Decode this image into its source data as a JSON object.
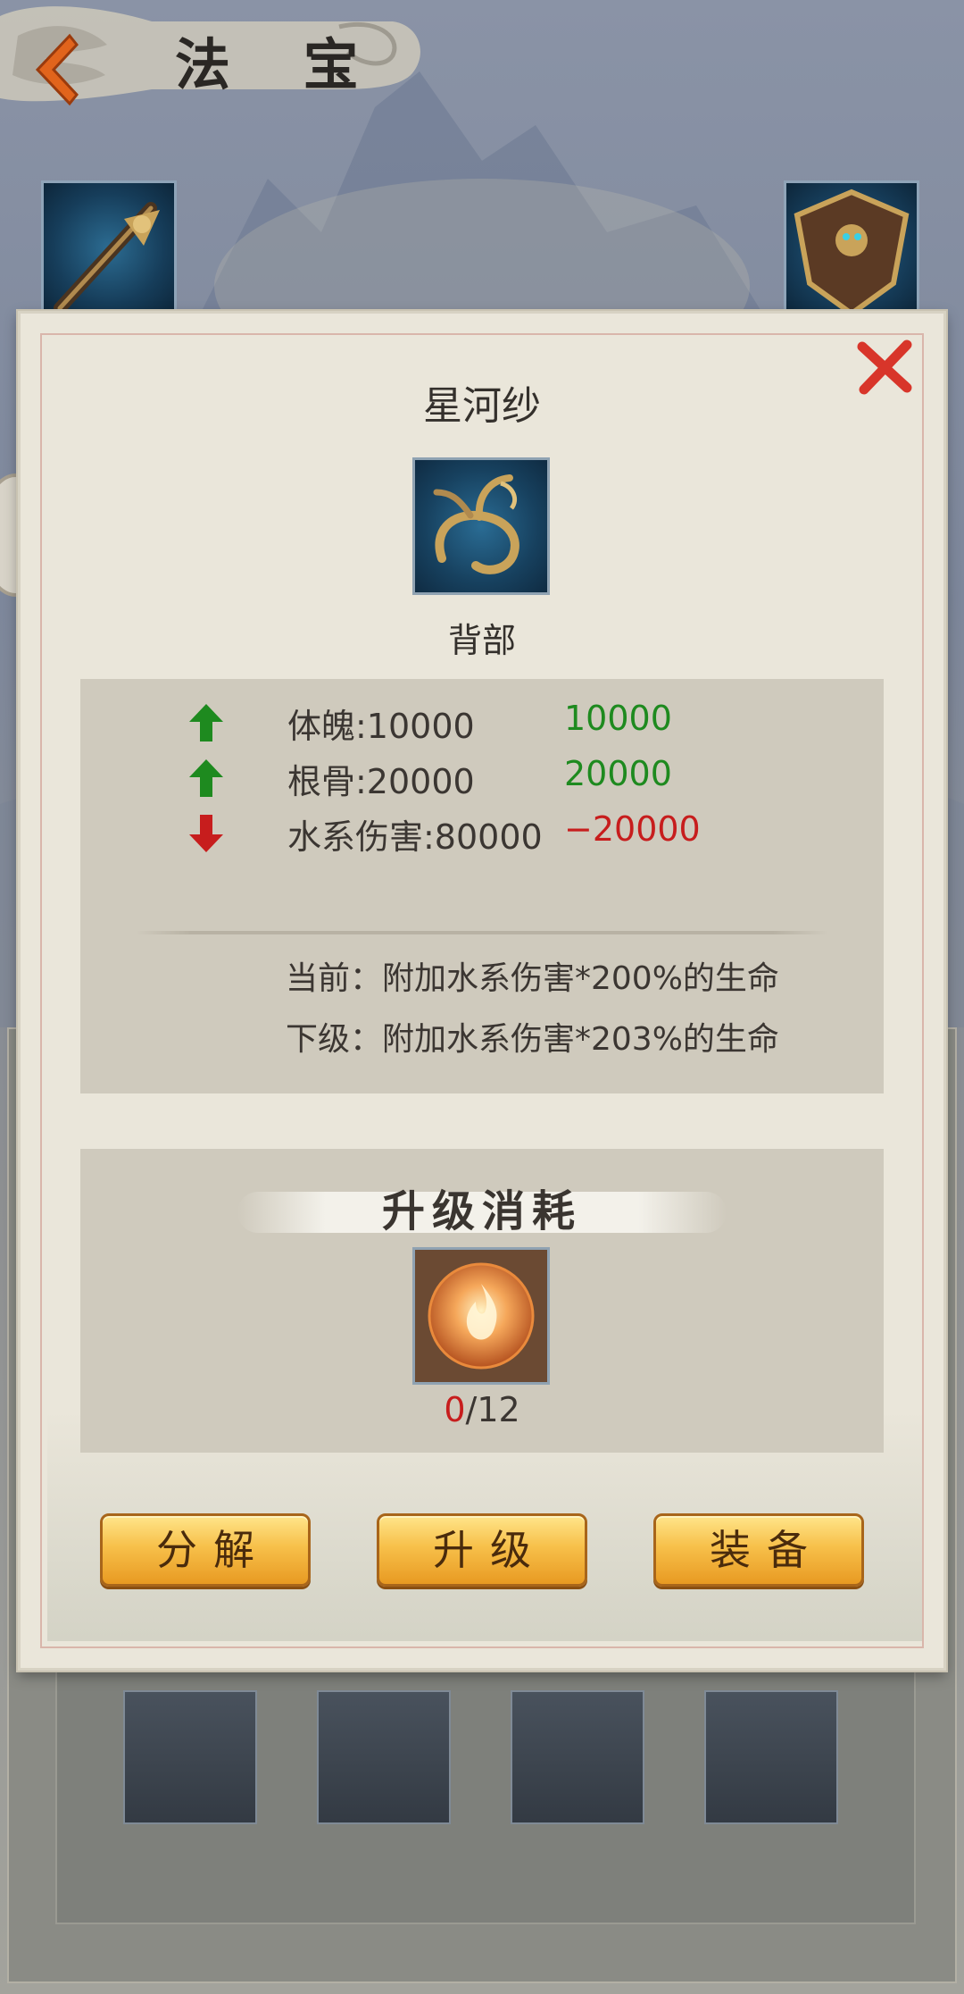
{
  "header": {
    "title": "法 宝"
  },
  "dialog": {
    "item_name": "星河纱",
    "item_slot": "背部",
    "stats": [
      {
        "label": "体魄:10000",
        "delta": "10000",
        "direction": "up"
      },
      {
        "label": "根骨:20000",
        "delta": "20000",
        "direction": "up"
      },
      {
        "label": "水系伤害:80000",
        "delta": "−20000",
        "direction": "down"
      }
    ],
    "effects": {
      "current": "当前：附加水系伤害*200%的生命",
      "next": "下级：附加水系伤害*203%的生命"
    },
    "cost": {
      "title": "升级消耗",
      "have": "0",
      "need": "/12"
    },
    "buttons": {
      "decompose": "分解",
      "upgrade": "升级",
      "equip": "装备"
    }
  },
  "colors": {
    "stat_up": "#1e8a1f",
    "stat_down": "#c71d1d",
    "button_gold": "#f7c04a",
    "close_red": "#d8352a"
  },
  "icons": {
    "back": "back-arrow-icon",
    "close": "close-x-icon",
    "up": "arrow-up-icon",
    "down": "arrow-down-icon"
  }
}
